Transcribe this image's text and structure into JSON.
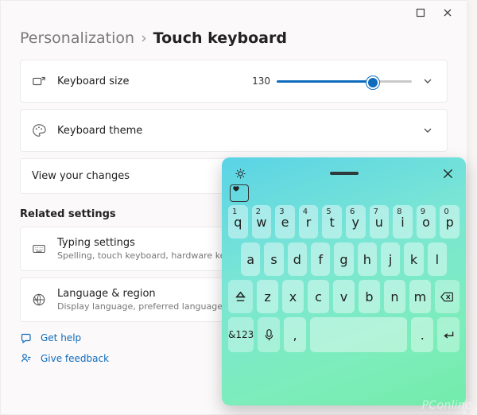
{
  "breadcrumb": {
    "parent": "Personalization",
    "sep": "›",
    "current": "Touch keyboard"
  },
  "rows": {
    "size": {
      "label": "Keyboard size",
      "value": "130",
      "fill_pct": 70
    },
    "theme": {
      "label": "Keyboard theme"
    },
    "view": {
      "label": "View your changes"
    }
  },
  "section_title": "Related settings",
  "related": [
    {
      "title": "Typing settings",
      "sub": "Spelling, touch keyboard, hardware keyboard"
    },
    {
      "title": "Language & region",
      "sub": "Display language, preferred language, region"
    }
  ],
  "help": {
    "get_help": "Get help",
    "feedback": "Give feedback"
  },
  "keyboard": {
    "r1_nums": [
      "1",
      "2",
      "3",
      "4",
      "5",
      "6",
      "7",
      "8",
      "9",
      "0"
    ],
    "r1": [
      "q",
      "w",
      "e",
      "r",
      "t",
      "y",
      "u",
      "i",
      "o",
      "p"
    ],
    "r2": [
      "a",
      "s",
      "d",
      "f",
      "g",
      "h",
      "j",
      "k",
      "l"
    ],
    "r3": [
      "z",
      "x",
      "c",
      "v",
      "b",
      "n",
      "m"
    ],
    "sym": "&123",
    "comma": ",",
    "period": "."
  },
  "watermark": "PConline"
}
